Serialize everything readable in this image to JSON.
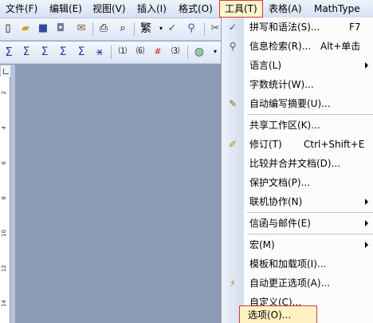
{
  "menubar": {
    "items": [
      {
        "label": "文件(F)"
      },
      {
        "label": "编辑(E)"
      },
      {
        "label": "视图(V)"
      },
      {
        "label": "插入(I)"
      },
      {
        "label": "格式(O)"
      },
      {
        "label": "工具(T)"
      },
      {
        "label": "表格(A)"
      },
      {
        "label": "MathType"
      }
    ]
  },
  "toolbar": {
    "style_glyph": "繁"
  },
  "ruler": {
    "ticks": [
      "2",
      "4",
      "6",
      "8",
      "10",
      "12",
      "14"
    ]
  },
  "tools_menu": {
    "items": [
      {
        "label": "拼写和语法(S)...",
        "shortcut": "F7"
      },
      {
        "label": "信息检索(R)...",
        "shortcut": "Alt+单击"
      },
      {
        "label": "语言(L)"
      },
      {
        "label": "字数统计(W)..."
      },
      {
        "label": "自动编写摘要(U)..."
      },
      {
        "label": "共享工作区(K)..."
      },
      {
        "label": "修订(T)",
        "shortcut": "Ctrl+Shift+E"
      },
      {
        "label": "比较并合并文档(D)..."
      },
      {
        "label": "保护文档(P)..."
      },
      {
        "label": "联机协作(N)"
      },
      {
        "label": "信函与邮件(E)"
      },
      {
        "label": "宏(M)"
      },
      {
        "label": "模板和加载项(I)..."
      },
      {
        "label": "自动更正选项(A)..."
      },
      {
        "label": "自定义(C)..."
      },
      {
        "label": "选项(O)..."
      }
    ]
  }
}
